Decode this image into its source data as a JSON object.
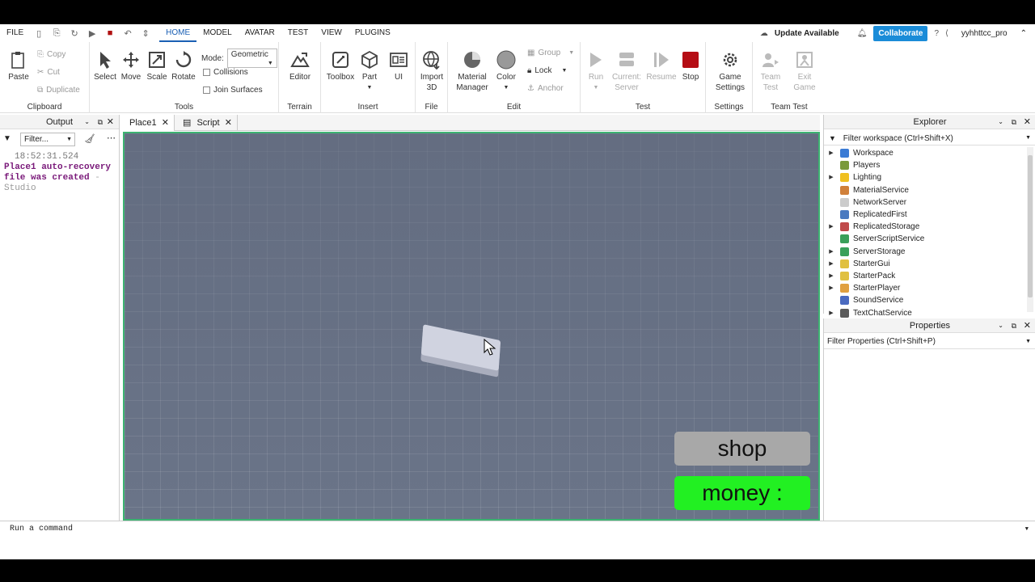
{
  "menubar": {
    "file": "FILE",
    "tabs": [
      "HOME",
      "MODEL",
      "AVATAR",
      "TEST",
      "VIEW",
      "PLUGINS"
    ],
    "update": "Update Available",
    "collaborate": "Collaborate",
    "username": "yyhhttcc_pro"
  },
  "ribbon": {
    "clipboard": {
      "paste": "Paste",
      "copy": "Copy",
      "cut": "Cut",
      "duplicate": "Duplicate",
      "label": "Clipboard"
    },
    "tools": {
      "select": "Select",
      "move": "Move",
      "scale": "Scale",
      "rotate": "Rotate",
      "mode_label": "Mode:",
      "mode_value": "Geometric",
      "collisions": "Collisions",
      "join": "Join Surfaces",
      "label": "Tools"
    },
    "terrain": {
      "editor": "Editor",
      "label": "Terrain"
    },
    "insert": {
      "toolbox": "Toolbox",
      "part": "Part",
      "ui": "UI",
      "label": "Insert"
    },
    "file": {
      "import": "Import",
      "import2": "3D",
      "label": "File"
    },
    "edit": {
      "material": "Material",
      "material2": "Manager",
      "color": "Color",
      "group": "Group",
      "lock": "Lock",
      "anchor": "Anchor",
      "label": "Edit"
    },
    "test": {
      "run": "Run",
      "current": "Current:",
      "server": "Server",
      "resume": "Resume",
      "stop": "Stop",
      "label": "Test"
    },
    "settings": {
      "game": "Game",
      "settings": "Settings",
      "label": "Settings"
    },
    "teamtest": {
      "team": "Team",
      "test": "Test",
      "exit": "Exit",
      "game": "Game",
      "label": "Team Test"
    }
  },
  "output": {
    "title": "Output",
    "filter_placeholder": "Filter...",
    "timestamp": "18:52:31.524",
    "message": "Place1 auto-recovery file was created",
    "dash": "-",
    "source": "Studio"
  },
  "tabs": {
    "place": "Place1",
    "script": "Script"
  },
  "viewport": {
    "shop": "shop",
    "money": "money :"
  },
  "explorer": {
    "title": "Explorer",
    "filter": "Filter workspace (Ctrl+Shift+X)",
    "items": [
      {
        "label": "Workspace",
        "color": "#3a7bd5",
        "arrow": true
      },
      {
        "label": "Players",
        "color": "#7a9a3a",
        "arrow": false
      },
      {
        "label": "Lighting",
        "color": "#f0c020",
        "arrow": true
      },
      {
        "label": "MaterialService",
        "color": "#d0803a",
        "arrow": false
      },
      {
        "label": "NetworkServer",
        "color": "#cccccc",
        "arrow": false
      },
      {
        "label": "ReplicatedFirst",
        "color": "#4a7ac0",
        "arrow": false
      },
      {
        "label": "ReplicatedStorage",
        "color": "#c04a4a",
        "arrow": true
      },
      {
        "label": "ServerScriptService",
        "color": "#3aa05a",
        "arrow": false
      },
      {
        "label": "ServerStorage",
        "color": "#3aa05a",
        "arrow": true
      },
      {
        "label": "StarterGui",
        "color": "#e0c040",
        "arrow": true
      },
      {
        "label": "StarterPack",
        "color": "#e0c040",
        "arrow": true
      },
      {
        "label": "StarterPlayer",
        "color": "#e0a040",
        "arrow": true
      },
      {
        "label": "SoundService",
        "color": "#4a6ac0",
        "arrow": false
      },
      {
        "label": "TextChatService",
        "color": "#5a5a5a",
        "arrow": true
      }
    ]
  },
  "properties": {
    "title": "Properties",
    "filter": "Filter Properties (Ctrl+Shift+P)"
  },
  "command": {
    "placeholder": "Run a command"
  }
}
